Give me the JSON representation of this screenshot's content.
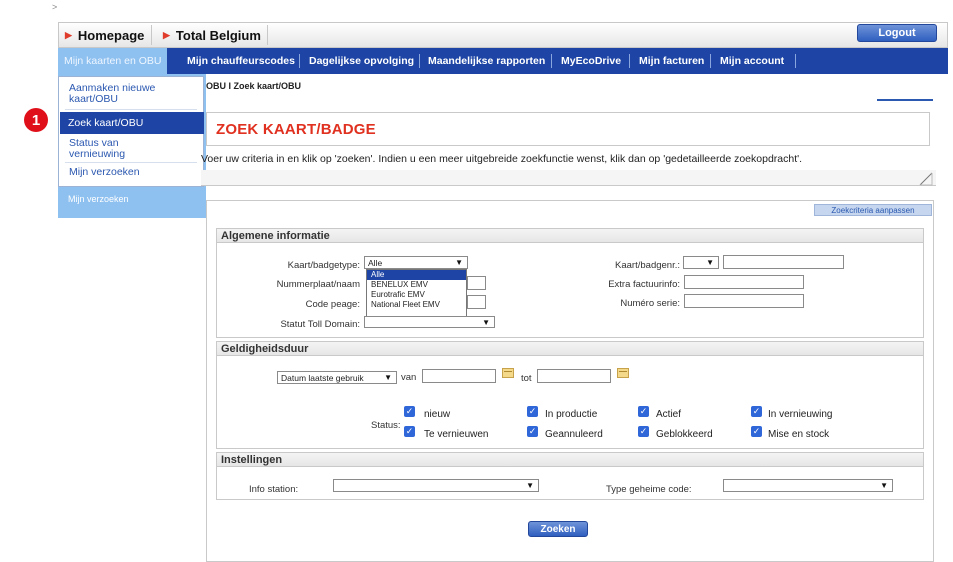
{
  "top_marker": ">",
  "header": {
    "tab_homepage": "Homepage",
    "tab_total_belgium": "Total Belgium",
    "logout": "Logout"
  },
  "nav": {
    "items": [
      {
        "label": "Mijn kaarten en OBU"
      },
      {
        "label": "Mijn chauffeurscodes"
      },
      {
        "label": "Dagelijkse opvolging"
      },
      {
        "label": "Maandelijkse rapporten"
      },
      {
        "label": "MyEcoDrive"
      },
      {
        "label": "Mijn facturen"
      },
      {
        "label": "Mijn account"
      }
    ]
  },
  "dropdown_menu": {
    "item1_line1": "Aanmaken nieuwe",
    "item1_line2": "kaart/OBU",
    "item2": "Zoek kaart/OBU",
    "item3_line1": "Status van",
    "item3_line2": "vernieuwing",
    "item4": "Mijn verzoeken"
  },
  "left_panel_link": "Mijn verzoeken",
  "badge_number": "1",
  "breadcrumb": "OBU I Zoek kaart/OBU",
  "page_title": "ZOEK KAART/BADGE",
  "intro_text": "Voer uw criteria in en klik op 'zoeken'. Indien u een meer uitgebreide zoekfunctie wenst, klik dan op 'gedetailleerde zoekopdracht'.",
  "zoekcriteria_button": "Zoekcriteria aanpassen",
  "algemene": {
    "title": "Algemene informatie",
    "kaarttype_label": "Kaart/badgetype:",
    "kaarttype_value": "Alle",
    "kaarttype_options": [
      "Alle",
      "BENELUX EMV",
      "Eurotrafic EMV",
      "National Fleet EMV"
    ],
    "nummerplaat_label": "Nummerplaat/naam",
    "code_peage_label": "Code peage:",
    "statut_label": "Statut Toll Domain:",
    "kaartnr_label": "Kaart/badgenr.:",
    "extra_label": "Extra factuurinfo:",
    "numero_label": "Numéro serie:"
  },
  "geldigheid": {
    "title": "Geldigheidsduur",
    "date_type": "Datum laatste gebruik",
    "van": "van",
    "tot": "tot",
    "status_label": "Status:",
    "checkboxes": [
      {
        "label": "nieuw",
        "checked": true
      },
      {
        "label": "In productie",
        "checked": true
      },
      {
        "label": "Actief",
        "checked": true
      },
      {
        "label": "In vernieuwing",
        "checked": true
      },
      {
        "label": "Te vernieuwen",
        "checked": true
      },
      {
        "label": "Geannuleerd",
        "checked": true
      },
      {
        "label": "Geblokkeerd",
        "checked": true
      },
      {
        "label": "Mise en stock",
        "checked": true
      }
    ]
  },
  "instellingen": {
    "title": "Instellingen",
    "info_station_label": "Info station:",
    "type_code_label": "Type geheime code:"
  },
  "zoeken_button": "Zoeken",
  "colors": {
    "nav_blue": "#1e45a5",
    "accent_red": "#e0301f",
    "active_nav": "#8ec0f0"
  }
}
